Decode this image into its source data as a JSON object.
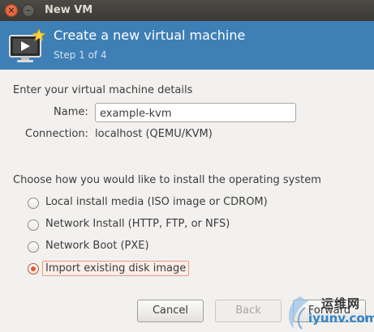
{
  "window": {
    "title": "New VM",
    "close_glyph": "×",
    "minimize_glyph": "–"
  },
  "header": {
    "title": "Create a new virtual machine",
    "step": "Step 1 of 4",
    "icon": "vm-monitor-icon",
    "background_color": "#3e7fb6"
  },
  "details": {
    "section_title": "Enter your virtual machine details",
    "name_label": "Name:",
    "name_value": "example-kvm",
    "connection_label": "Connection:",
    "connection_value": "localhost (QEMU/KVM)"
  },
  "install": {
    "section_title": "Choose how you would like to install the operating system",
    "options": [
      {
        "label": "Local install media (ISO image or CDROM)",
        "selected": false
      },
      {
        "label": "Network Install (HTTP, FTP, or NFS)",
        "selected": false
      },
      {
        "label": "Network Boot (PXE)",
        "selected": false
      },
      {
        "label": "Import existing disk image",
        "selected": true
      }
    ],
    "accent_color": "#e35a2b"
  },
  "buttons": {
    "cancel": "Cancel",
    "back": "Back",
    "forward": "Forward"
  },
  "watermark": {
    "cn_text": "运维网",
    "url_text": "iyunv.com"
  }
}
